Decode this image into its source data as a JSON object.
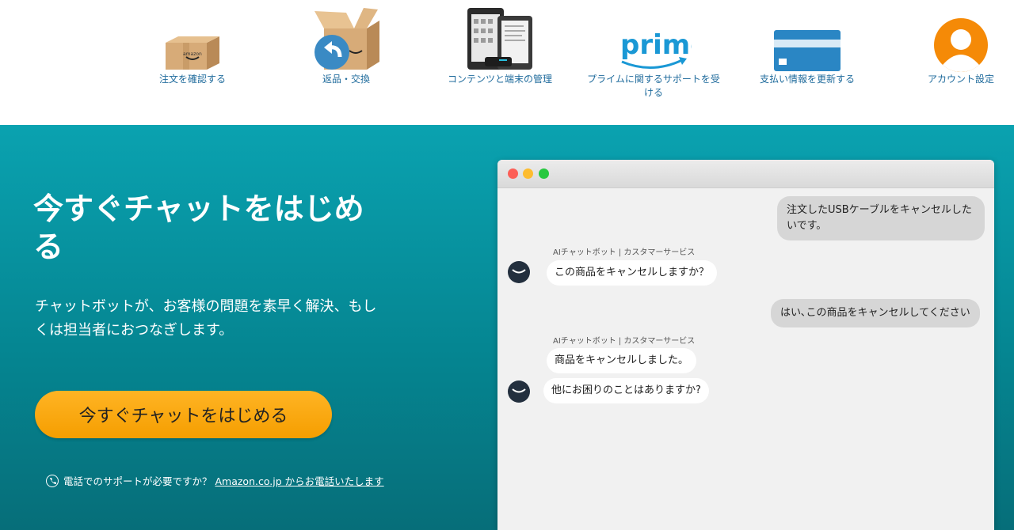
{
  "tiles": [
    {
      "label": "注文を確認する"
    },
    {
      "label": "返品・交換"
    },
    {
      "label": "コンテンツと端末の管理"
    },
    {
      "label": "プライムに関するサポートを受ける",
      "logo_text": "prime"
    },
    {
      "label": "支払い情報を更新する"
    },
    {
      "label": "アカウント設定"
    }
  ],
  "hero": {
    "title": "今すぐチャットをはじめる",
    "description": "チャットボットが、お客様の問題を素早く解決、もしくは担当者におつなぎします。",
    "cta_label": "今すぐチャットをはじめる",
    "phone_text": "電話でのサポートが必要ですか？ ",
    "phone_link": "Amazon.co.jp からお電話いたします"
  },
  "chat": {
    "messages": [
      {
        "from": "user",
        "text": "注文したUSBケーブルをキャンセルしたいです。"
      },
      {
        "from": "bot",
        "sender": "AIチャットボット | カスタマーサービス",
        "text": "この商品をキャンセルしますか？"
      },
      {
        "from": "user",
        "text": "はい､この商品をキャンセルしてください"
      },
      {
        "from": "bot",
        "sender": "AIチャットボット | カスタマーサービス",
        "text": "商品をキャンセルしました。"
      },
      {
        "from": "bot",
        "text": "他にお困りのことはありますか?"
      }
    ]
  },
  "colors": {
    "band_top": "#0aa2b0",
    "band_bottom": "#066e79",
    "cta": "#f5a300",
    "link_blue": "#1f6b9c",
    "account_orange": "#f58a07",
    "card_blue": "#2a86c4"
  },
  "icons": [
    "amazon-box-icon",
    "return-box-icon",
    "kindle-devices-icon",
    "prime-logo-icon",
    "credit-card-icon",
    "account-avatar-icon",
    "phone-icon",
    "amazon-smile-avatar-icon"
  ]
}
